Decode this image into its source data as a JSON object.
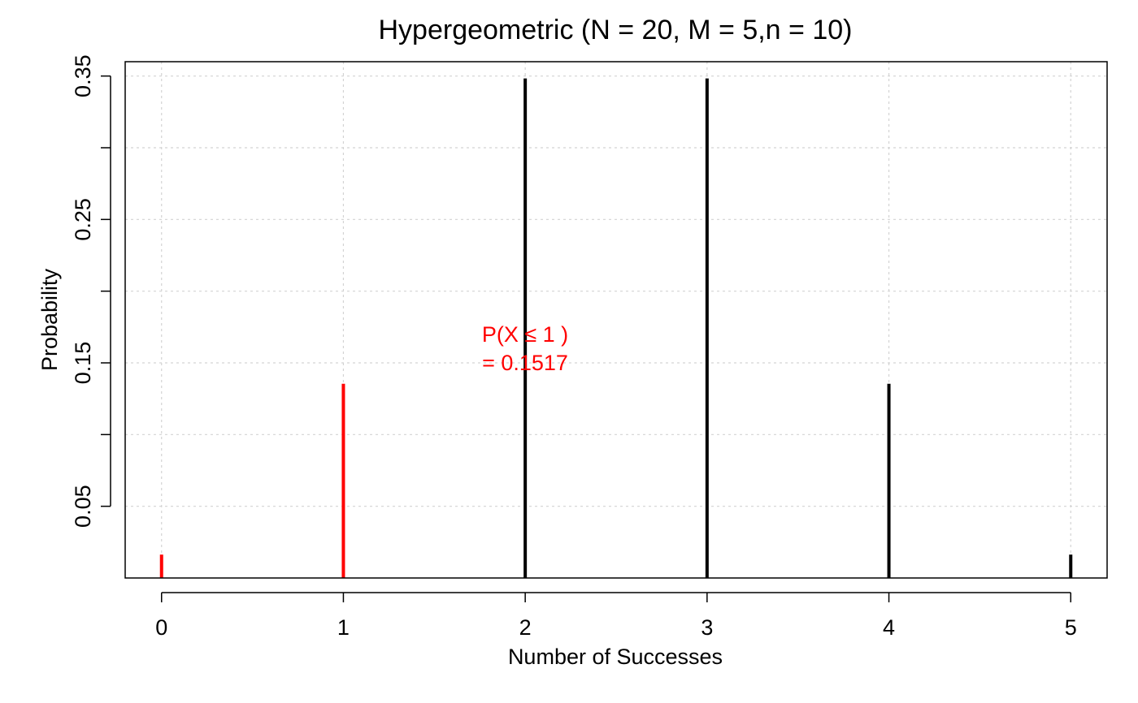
{
  "chart_data": {
    "type": "bar",
    "title": "Hypergeometric (N = 20, M = 5,n = 10)",
    "xlabel": "Number of Successes",
    "ylabel": "Probability",
    "x": [
      0,
      1,
      2,
      3,
      4,
      5
    ],
    "values": [
      0.0163,
      0.1354,
      0.3483,
      0.3483,
      0.1354,
      0.0163
    ],
    "highlight_x_max": 1,
    "colors": {
      "highlight": "#ff0000",
      "default": "#000000",
      "grid": "#d3d3d3"
    },
    "annotation": {
      "line1": "P(X ≤  1 )",
      "line2": " =  0.1517"
    },
    "xticks": [
      "0",
      "1",
      "2",
      "3",
      "4",
      "5"
    ],
    "yticks": [
      "0.05",
      "0.15",
      "0.25",
      "0.35"
    ],
    "xlim": [
      -0.2,
      5.2
    ],
    "ylim": [
      0,
      0.36
    ],
    "grid": true
  }
}
